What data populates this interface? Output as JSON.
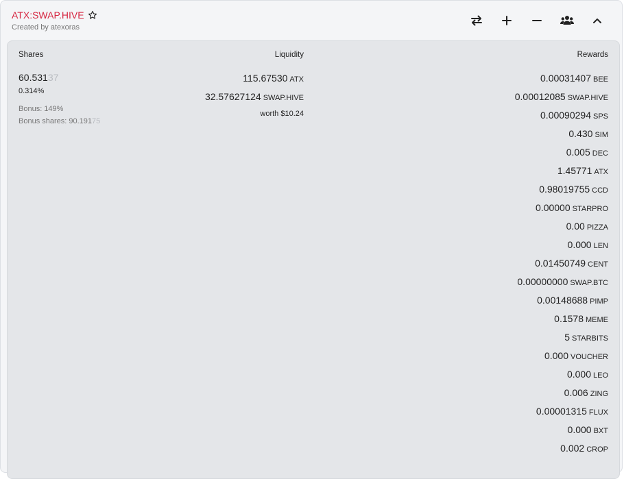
{
  "pool": {
    "name": "ATX:SWAP.HIVE",
    "created_by": "Created by atexoras"
  },
  "actions": [
    {
      "name": "swap-icon"
    },
    {
      "name": "plus-icon"
    },
    {
      "name": "minus-icon"
    },
    {
      "name": "users-icon"
    },
    {
      "name": "chevron-up-icon"
    }
  ],
  "headers": {
    "shares": "Shares",
    "liquidity": "Liquidity",
    "rewards": "Rewards"
  },
  "shares": {
    "value_main": "60.531",
    "value_dim": "37",
    "percent": "0.314%",
    "bonus": "Bonus: 149%",
    "bonus_shares_main": "Bonus shares: 90.191",
    "bonus_shares_dim": "75"
  },
  "liquidity": {
    "rows": [
      {
        "main": "115.",
        "dim": "67530",
        "token": "ATX"
      },
      {
        "main": "32.576",
        "dim": "27124",
        "token": "SWAP.HIVE"
      }
    ],
    "worth": "worth $10.24"
  },
  "rewards": [
    {
      "main": "0.00031407",
      "dim": "",
      "token": "BEE"
    },
    {
      "main": "0.00012085",
      "dim": "",
      "token": "SWAP.HIVE"
    },
    {
      "main": "0.00090294",
      "dim": "",
      "token": "SPS"
    },
    {
      "main": "0.43",
      "dim": "0",
      "token": "SIM"
    },
    {
      "main": "0.005",
      "dim": "",
      "token": "DEC"
    },
    {
      "main": "1.45771",
      "dim": "",
      "token": "ATX"
    },
    {
      "main": "0.98019755",
      "dim": "",
      "token": "CCD"
    },
    {
      "main": "0.",
      "dim": "00000",
      "token": "STARPRO"
    },
    {
      "main": "0.",
      "dim": "00",
      "token": "PIZZA"
    },
    {
      "main": "0.",
      "dim": "000",
      "token": "LEN"
    },
    {
      "main": "0.01450749",
      "dim": "",
      "token": "CENT"
    },
    {
      "main": "0.",
      "dim": "00000000",
      "token": "SWAP.BTC"
    },
    {
      "main": "0.00148688",
      "dim": "",
      "token": "PIMP"
    },
    {
      "main": "0.1578",
      "dim": "",
      "token": "MEME"
    },
    {
      "main": "5",
      "dim": "",
      "token": "STARBITS"
    },
    {
      "main": "0.",
      "dim": "000",
      "token": "VOUCHER"
    },
    {
      "main": "0.",
      "dim": "000",
      "token": "LEO"
    },
    {
      "main": "0.006",
      "dim": "",
      "token": "ZING"
    },
    {
      "main": "0.00001315",
      "dim": "",
      "token": "FLUX"
    },
    {
      "main": "0.",
      "dim": "000",
      "token": "BXT"
    },
    {
      "main": "0.002",
      "dim": "",
      "token": "CROP"
    }
  ]
}
